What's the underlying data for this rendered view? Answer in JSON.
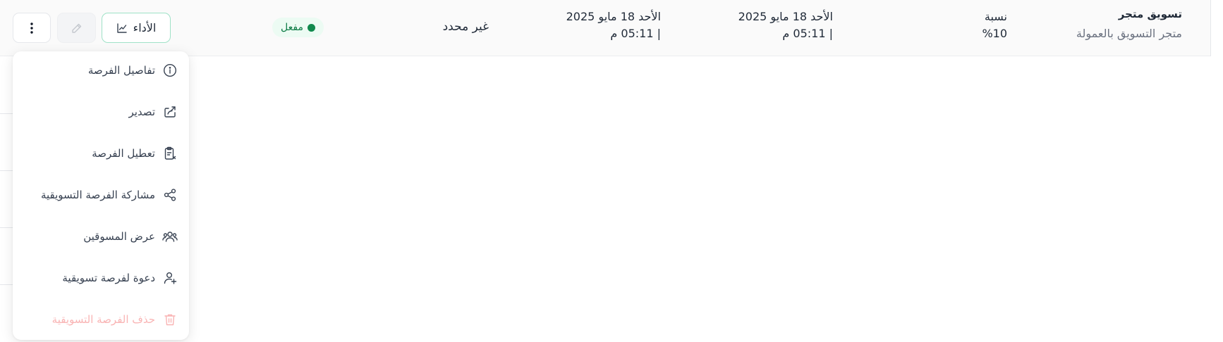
{
  "row": {
    "store": {
      "title": "تسويق متجر",
      "subtitle": "متجر التسويق بالعمولة"
    },
    "commission": {
      "label": "نسبة",
      "value": "%10"
    },
    "start_date": {
      "line1": "الأحد 18 مايو 2025",
      "line2": "| 05:11 م"
    },
    "end_date": {
      "line1": "الأحد 18 مايو 2025",
      "line2": "| 05:11 م"
    },
    "limit": "غير محدد",
    "status": {
      "label": "مفعل",
      "color": "#10894d"
    },
    "performance_label": "الأداء"
  },
  "menu": {
    "items": [
      {
        "label": "تفاصيل الفرصة",
        "icon": "info-icon"
      },
      {
        "label": "تصدير",
        "icon": "export-icon"
      },
      {
        "label": "تعطيل الفرصة",
        "icon": "clipboard-x-icon"
      },
      {
        "label": "مشاركة الفرصة التسويقية",
        "icon": "share-icon"
      },
      {
        "label": "عرض المسوقين",
        "icon": "users-icon"
      },
      {
        "label": "دعوة لفرصة تسويقية",
        "icon": "user-plus-icon"
      },
      {
        "label": "حذف الفرصة التسويقية",
        "icon": "trash-icon",
        "color": "#f9b4b4"
      }
    ]
  },
  "colors": {
    "accent": "#10894d",
    "badge_bg": "#ecfbf3",
    "danger_light": "#f9b4b4"
  }
}
